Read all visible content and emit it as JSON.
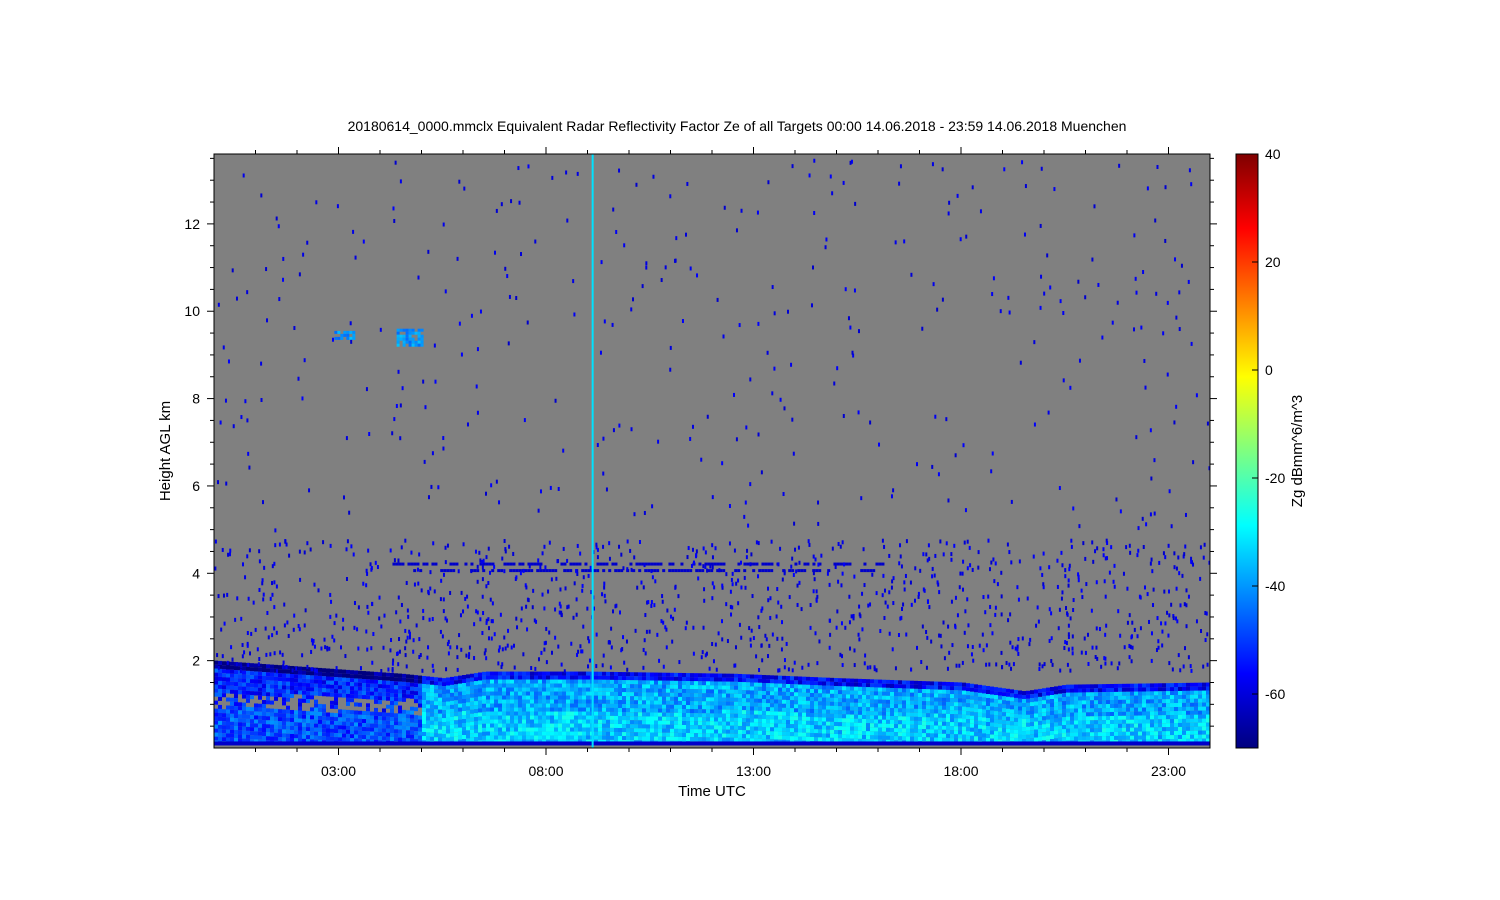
{
  "chart_data": {
    "type": "heatmap",
    "title": "20180614_0000.mmclx Equivalent Radar Reflectivity Factor Ze of all Targets   00:00 14.06.2018 - 23:59 14.06.2018 Muenchen",
    "xlabel": "Time UTC",
    "ylabel": "Height AGL km",
    "x_tick_labels": [
      "03:00",
      "08:00",
      "13:00",
      "18:00",
      "23:00"
    ],
    "x_tick_hours": [
      3,
      8,
      13,
      18,
      23
    ],
    "xlim_hours": [
      0,
      24
    ],
    "y_ticks": [
      2,
      4,
      6,
      8,
      10,
      12
    ],
    "ylim": [
      0,
      13.6
    ],
    "background_color": "#808080",
    "colorbar": {
      "label": "Zg dBmm^6/m^3",
      "ticks": [
        40,
        20,
        0,
        -20,
        -40,
        -60
      ],
      "range": [
        -70,
        40
      ],
      "colormap": "jet"
    },
    "features": [
      {
        "desc": "boundary layer echo",
        "start_h": 0,
        "end_h": 24,
        "top_km": [
          [
            0,
            2.0
          ],
          [
            4.5,
            1.7
          ],
          [
            5.5,
            1.6
          ],
          [
            6.5,
            1.75
          ],
          [
            9,
            1.75
          ],
          [
            12.5,
            1.7
          ],
          [
            15,
            1.6
          ],
          [
            18,
            1.5
          ],
          [
            19.5,
            1.3
          ],
          [
            20.5,
            1.45
          ],
          [
            24,
            1.5
          ]
        ],
        "value_dbz": -38
      },
      {
        "desc": "cirrus patch",
        "start_h": 2.9,
        "end_h": 3.4,
        "base_km": 9.4,
        "top_km": 9.55,
        "value_dbz": -40
      },
      {
        "desc": "cirrus patch",
        "start_h": 4.4,
        "end_h": 5.0,
        "base_km": 9.2,
        "top_km": 9.6,
        "value_dbz": -40
      },
      {
        "desc": "noise layer",
        "start_h": 4.3,
        "end_h": 16.2,
        "height_km": 4.2,
        "value_dbz": -62
      },
      {
        "desc": "noise layer",
        "start_h": 4.8,
        "end_h": 16.0,
        "height_km": 4.05,
        "value_dbz": -62
      },
      {
        "desc": "vertical spike",
        "time_h": 9.1,
        "value_dbz": -32
      }
    ]
  }
}
